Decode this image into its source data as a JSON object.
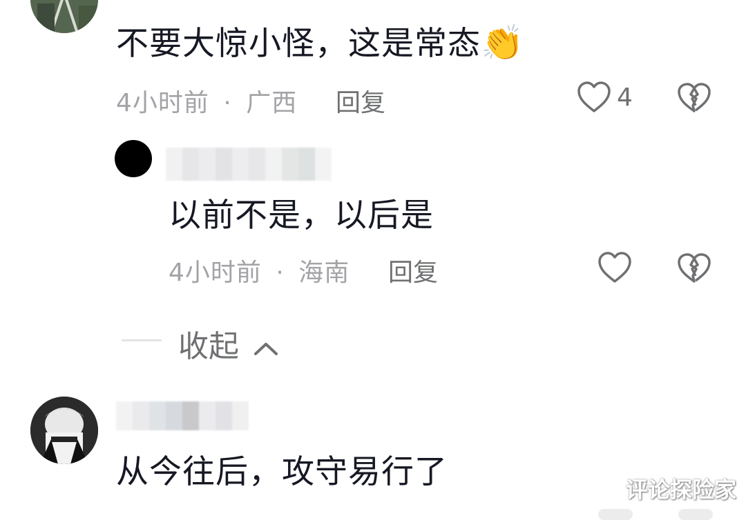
{
  "comments": [
    {
      "text": "不要大惊小怪，这是常态",
      "emoji": "👏",
      "time": "4小时前",
      "separator": "·",
      "location": "广西",
      "reply_label": "回复",
      "likes": "4"
    },
    {
      "text": "从今往后，攻守易行了"
    }
  ],
  "reply": {
    "text": "以前不是，以后是",
    "time": "4小时前",
    "separator": "·",
    "location": "海南",
    "reply_label": "回复"
  },
  "collapse_label": "收起",
  "watermark": "评论探险家",
  "icons": {
    "like": "heart-outline-icon",
    "dislike": "broken-heart-icon",
    "collapse": "chevron-up-icon"
  },
  "colors": {
    "text": "#161823",
    "meta": "#a3a3a7",
    "secondary": "#6f7072"
  }
}
